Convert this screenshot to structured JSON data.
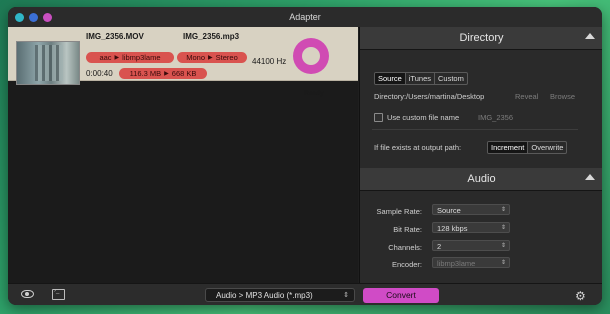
{
  "window": {
    "title": "Adapter"
  },
  "job": {
    "input_name": "IMG_2356.MOV",
    "output_name": "IMG_2356.mp3",
    "codec_from": "aac",
    "codec_to": "libmp3lame",
    "channels_from": "Mono",
    "channels_to": "Stereo",
    "frequency": "44100 Hz",
    "duration": "0:00:40",
    "size_from": "116.3 MB",
    "size_to": "668 KB",
    "status": "Ready"
  },
  "directory": {
    "header": "Directory",
    "tabs": [
      "Source",
      "iTunes",
      "Custom"
    ],
    "selected_tab": "Source",
    "directory_label": "Directory:",
    "directory_value": "/Users/martina/Desktop",
    "reveal_label": "Reveal",
    "browse_label": "Browse",
    "custom_name_label": "Use custom file name",
    "custom_name_placeholder": "IMG_2356",
    "exists_label": "If file exists at output path:",
    "exists_options": [
      "Increment",
      "Overwrite"
    ]
  },
  "audio": {
    "header": "Audio",
    "sample_rate_label": "Sample Rate:",
    "sample_rate_value": "Source",
    "bit_rate_label": "Bit Rate:",
    "bit_rate_value": "128 kbps",
    "channels_label": "Channels:",
    "channels_value": "2",
    "encoder_label": "Encoder:",
    "encoder_value": "libmp3lame"
  },
  "bottom": {
    "format_value": "Audio > MP3 Audio (*.mp3)",
    "convert_label": "Convert"
  },
  "icons": [
    "eye-icon",
    "terminal-icon",
    "gear-icon",
    "chevron-up-icon",
    "chevron-updown-icon"
  ],
  "colors": {
    "accent": "#d04bc6",
    "pill": "#d9534f",
    "ring": "#d04bb3"
  }
}
